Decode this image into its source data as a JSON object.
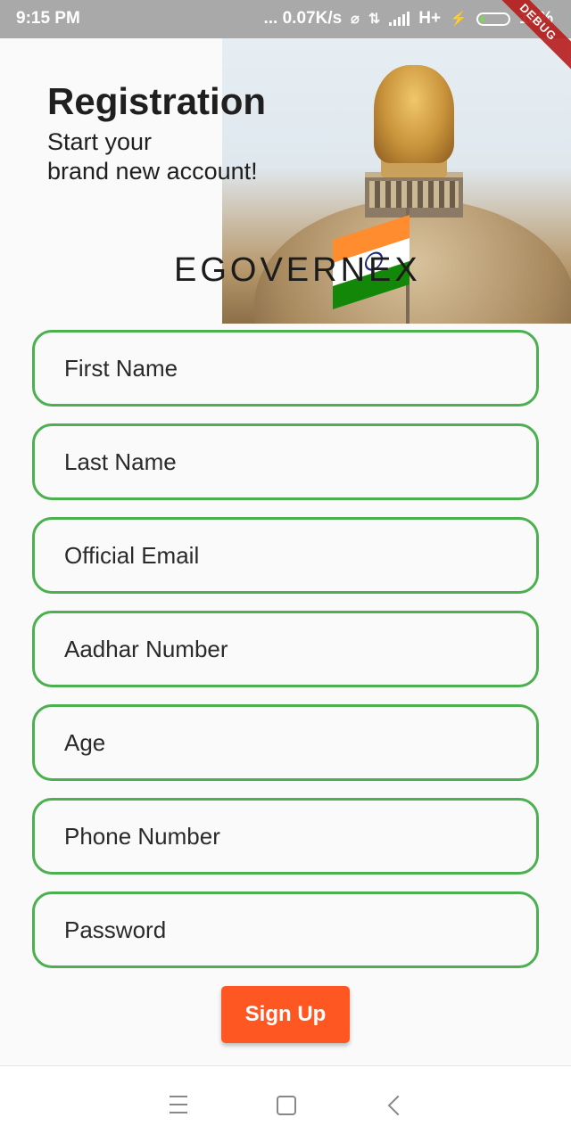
{
  "status_bar": {
    "time": "9:15 PM",
    "net_speed": "... 0.07K/s",
    "network_type": "H+",
    "battery": "13%",
    "debug_banner": "DEBUG"
  },
  "header": {
    "title": "Registration",
    "subtitle": "Start  your\nbrand new  account!",
    "brand": "EGOVERNEX"
  },
  "form": {
    "fields": [
      {
        "placeholder": "First Name"
      },
      {
        "placeholder": "Last Name"
      },
      {
        "placeholder": "Official Email"
      },
      {
        "placeholder": "Aadhar Number"
      },
      {
        "placeholder": "Age"
      },
      {
        "placeholder": "Phone Number"
      },
      {
        "placeholder": "Password"
      }
    ],
    "submit_label": "Sign Up"
  },
  "colors": {
    "field_border": "#4caf50",
    "button": "#ff5722",
    "status_bar": "#a9a9a9"
  },
  "nav_bar": {
    "icons": [
      "menu-icon",
      "home-icon",
      "back-icon"
    ]
  }
}
